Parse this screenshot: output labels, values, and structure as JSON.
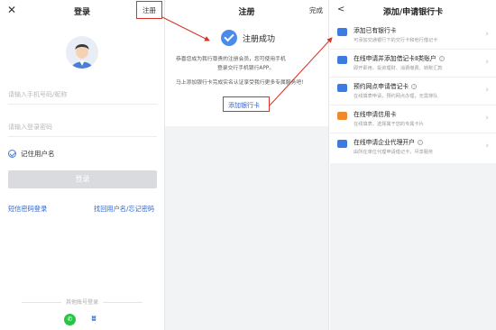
{
  "login_screen": {
    "close_glyph": "✕",
    "title": "登录",
    "register_link": "注册",
    "phone_placeholder": "请输入手机号码/昵称",
    "password_placeholder": "请输入登录密码",
    "remember_label": "记住用户名",
    "login_button": "登录",
    "sms_login_link": "短信密码登录",
    "recover_link": "找回用户名/忘记密码",
    "other_login_label": "其他账号登录",
    "wechat_icon": "wechat-icon",
    "alt_login_icon": "alt-login-icon"
  },
  "register_screen": {
    "title": "注册",
    "done_label": "完成",
    "success_text": "注册成功",
    "message_line1": "恭喜您成为我行尊贵的注册会员，您可使用手机",
    "message_line2": "登录交行手机银行APP。",
    "message_line3": "马上添加银行卡完成实名认证享受我行更多专属服务吧!",
    "add_card_link": "添加银行卡"
  },
  "add_card_screen": {
    "back_glyph": "<",
    "title": "添加/申请银行卡",
    "items": [
      {
        "title": "添加已有银行卡",
        "subtitle": "可添加交通银行下的交行卡和他行借记卡",
        "icon": "card-add-icon",
        "color": "#3c7be0",
        "info": false
      },
      {
        "title": "在线申请并添加借记卡Ⅱ类账户",
        "subtitle": "即开即用，投资理财、消费缴费、转账汇款",
        "icon": "id-card-icon",
        "color": "#3c7be0",
        "info": true
      },
      {
        "title": "预约网点申请借记卡",
        "subtitle": "在线填表申请，预约网点办理，无需排队",
        "icon": "appointment-card-icon",
        "color": "#3c7be0",
        "info": true
      },
      {
        "title": "在线申请信用卡",
        "subtitle": "在线填表，选择属于您的专属卡片",
        "icon": "credit-card-icon",
        "color": "#ee8a2c",
        "info": false
      },
      {
        "title": "在线申请企业代理开户",
        "subtitle": "由所在单位代理申请借记卡，尽享服务",
        "icon": "enterprise-icon",
        "color": "#3c7be0",
        "info": true
      }
    ]
  },
  "colors": {
    "accent_red": "#d8352a",
    "link_blue": "#3366cc",
    "success_blue": "#4a8bea",
    "wechat_green": "#28c445"
  }
}
